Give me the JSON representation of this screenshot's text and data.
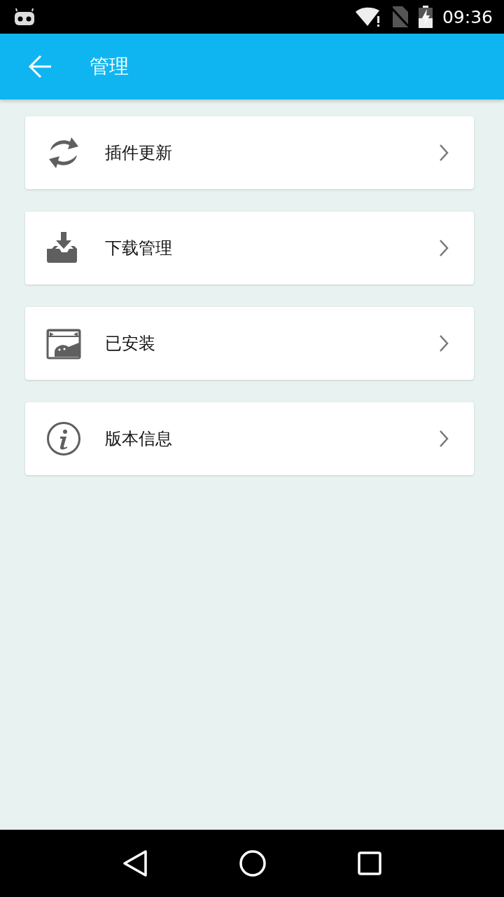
{
  "status_bar": {
    "time": "09:36"
  },
  "app_bar": {
    "title": "管理"
  },
  "items": [
    {
      "kind": "update",
      "label": "插件更新"
    },
    {
      "kind": "download",
      "label": "下载管理"
    },
    {
      "kind": "installed",
      "label": "已安装"
    },
    {
      "kind": "info",
      "label": "版本信息"
    }
  ]
}
